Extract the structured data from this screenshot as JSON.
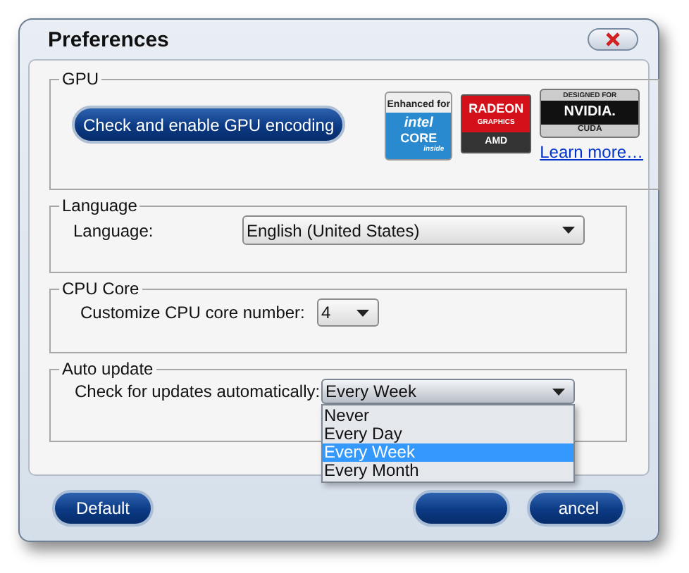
{
  "window": {
    "title": "Preferences"
  },
  "gpu": {
    "legend": "GPU",
    "button": "Check and enable GPU encoding",
    "link": "Learn more…",
    "logos": [
      {
        "kind": "intel",
        "lines": [
          "Enhanced for",
          "intel",
          "CORE",
          "inside"
        ]
      },
      {
        "kind": "amd",
        "lines": [
          "RADEON",
          "GRAPHICS",
          "AMD"
        ]
      },
      {
        "kind": "nvidia",
        "lines": [
          "DESIGNED FOR",
          "NVIDIA.",
          "CUDA"
        ]
      }
    ]
  },
  "language": {
    "legend": "Language",
    "label": "Language:",
    "value": "English (United States)"
  },
  "cpu": {
    "legend": "CPU Core",
    "label": "Customize CPU core number:",
    "value": "4"
  },
  "auto_update": {
    "legend": "Auto update",
    "label": "Check for updates automatically:",
    "value": "Every Week",
    "expanded": true,
    "options": [
      {
        "label": "Never",
        "selected": false
      },
      {
        "label": "Every Day",
        "selected": false
      },
      {
        "label": "Every Week",
        "selected": true
      },
      {
        "label": "Every Month",
        "selected": false
      }
    ]
  },
  "buttons": [
    {
      "kind": "default",
      "label": "Default"
    },
    {
      "kind": "ok"
    },
    {
      "kind": "cancel",
      "label": "ancel"
    }
  ]
}
